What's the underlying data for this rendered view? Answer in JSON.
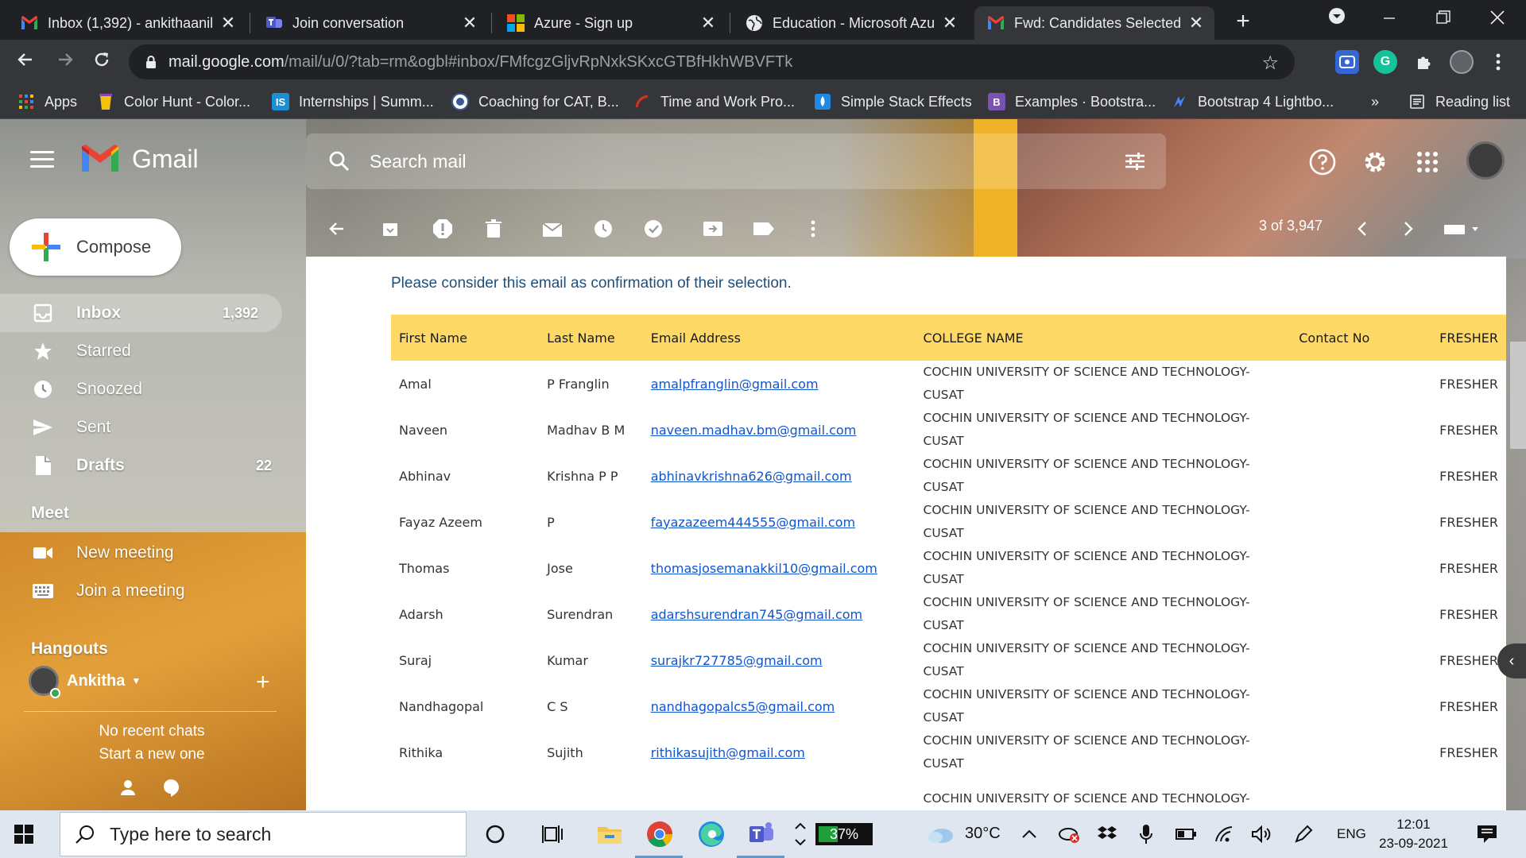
{
  "browser": {
    "tabs": [
      {
        "title": "Inbox (1,392) - ankithaanil",
        "icon": "gmail-icon",
        "active": false
      },
      {
        "title": "Join conversation",
        "icon": "teams-icon",
        "active": false
      },
      {
        "title": "Azure - Sign up",
        "icon": "microsoft-icon",
        "active": false
      },
      {
        "title": "Education - Microsoft Azu",
        "icon": "globe-icon",
        "active": false
      },
      {
        "title": "Fwd: Candidates Selected",
        "icon": "gmail-icon",
        "active": true
      }
    ],
    "close_glyph": "✕",
    "new_tab_glyph": "+",
    "url_host": "mail.google.com",
    "url_rest": "/mail/u/0/?tab=rm&ogbl#inbox/FMfcgzGljvRpNxkSKxcGTBfHkhWBVFTk",
    "bookmarks": [
      {
        "label": "Apps",
        "icon": "apps-grid-icon"
      },
      {
        "label": "Color Hunt - Color...",
        "icon": "color-hunt-icon"
      },
      {
        "label": "Internships | Summ...",
        "icon": "internshala-icon",
        "icon_text": "IS"
      },
      {
        "label": "Coaching for CAT, B...",
        "icon": "coaching-icon"
      },
      {
        "label": "Time and Work Pro...",
        "icon": "time-work-icon"
      },
      {
        "label": "Simple Stack Effects",
        "icon": "droplet-icon"
      },
      {
        "label": "Examples · Bootstra...",
        "icon": "bootstrap-icon",
        "icon_text": "B"
      },
      {
        "label": "Bootstrap 4 Lightbo...",
        "icon": "lightbox-icon"
      }
    ],
    "more_bookmarks": "»",
    "reading_list": "Reading list"
  },
  "gmail": {
    "logo_text": "Gmail",
    "search_placeholder": "Search mail",
    "compose_label": "Compose",
    "nav": [
      {
        "label": "Inbox",
        "count": "1,392",
        "icon": "inbox-icon",
        "selected": true
      },
      {
        "label": "Starred",
        "count": "",
        "icon": "star-icon",
        "selected": false
      },
      {
        "label": "Snoozed",
        "count": "",
        "icon": "clock-icon",
        "selected": false
      },
      {
        "label": "Sent",
        "count": "",
        "icon": "send-icon",
        "selected": false
      },
      {
        "label": "Drafts",
        "count": "22",
        "icon": "draft-icon",
        "selected": false
      }
    ],
    "meet": {
      "title": "Meet",
      "items": [
        {
          "label": "New meeting",
          "icon": "video-camera-icon"
        },
        {
          "label": "Join a meeting",
          "icon": "keyboard-icon"
        }
      ]
    },
    "hangouts": {
      "title": "Hangouts",
      "user": "Ankitha",
      "no_recent": "No recent chats",
      "start_new": "Start a new one"
    },
    "pager": "3 of 3,947",
    "accent_colors": {
      "compose_plus": [
        "#ea4335",
        "#fbbc04",
        "#34a853",
        "#4285f4"
      ],
      "table_header": "#ffd966",
      "link": "#1155cc"
    }
  },
  "email": {
    "intro": "Please consider this email as confirmation of their selection.",
    "columns": [
      "First Name",
      "Last Name",
      "Email Address",
      "COLLEGE NAME",
      "Contact No",
      "FRESHER"
    ],
    "rows": [
      {
        "first": "Amal",
        "last": "P Franglin",
        "email": "amalpfranglin@gmail.com",
        "college": "COCHIN UNIVERSITY OF SCIENCE AND TECHNOLOGY-CUSAT",
        "contact": "",
        "status": "FRESHER"
      },
      {
        "first": "Naveen",
        "last": "Madhav B M",
        "email": "naveen.madhav.bm@gmail.com",
        "college": "COCHIN UNIVERSITY OF SCIENCE AND TECHNOLOGY-CUSAT",
        "contact": "",
        "status": "FRESHER"
      },
      {
        "first": "Abhinav",
        "last": "Krishna P P",
        "email": "abhinavkrishna626@gmail.com",
        "college": "COCHIN UNIVERSITY OF SCIENCE AND TECHNOLOGY-CUSAT",
        "contact": "",
        "status": "FRESHER"
      },
      {
        "first": "Fayaz Azeem",
        "last": "P",
        "email": "fayazazeem444555@gmail.com",
        "college": "COCHIN UNIVERSITY OF SCIENCE AND TECHNOLOGY-CUSAT",
        "contact": "",
        "status": "FRESHER"
      },
      {
        "first": "Thomas",
        "last": "Jose",
        "email": "thomasjosemanakkil10@gmail.com",
        "college": "COCHIN UNIVERSITY OF SCIENCE AND TECHNOLOGY-CUSAT",
        "contact": "",
        "status": "FRESHER"
      },
      {
        "first": "Adarsh",
        "last": "Surendran",
        "email": "adarshsurendran745@gmail.com",
        "college": "COCHIN UNIVERSITY OF SCIENCE AND TECHNOLOGY-CUSAT",
        "contact": "",
        "status": "FRESHER"
      },
      {
        "first": "Suraj",
        "last": "Kumar",
        "email": "surajkr727785@gmail.com",
        "college": "COCHIN UNIVERSITY OF SCIENCE AND TECHNOLOGY-CUSAT",
        "contact": "",
        "status": "FRESHER"
      },
      {
        "first": "Nandhagopal",
        "last": "C S",
        "email": "nandhagopalcs5@gmail.com",
        "college": "COCHIN UNIVERSITY OF SCIENCE AND TECHNOLOGY-CUSAT",
        "contact": "",
        "status": "FRESHER"
      },
      {
        "first": "Rithika",
        "last": "Sujith",
        "email": "rithikasujith@gmail.com",
        "college": "COCHIN UNIVERSITY OF SCIENCE AND TECHNOLOGY-CUSAT",
        "contact": "",
        "status": "FRESHER"
      },
      {
        "first": "",
        "last": "",
        "email": "",
        "college": "COCHIN UNIVERSITY OF SCIENCE AND TECHNOLOGY-",
        "contact": "",
        "status": ""
      }
    ]
  },
  "taskbar": {
    "search_placeholder": "Type here to search",
    "battery": "37%",
    "battery_level": 0.37,
    "temperature": "30°C",
    "language": "ENG",
    "time": "12:01",
    "date": "23-09-2021"
  }
}
